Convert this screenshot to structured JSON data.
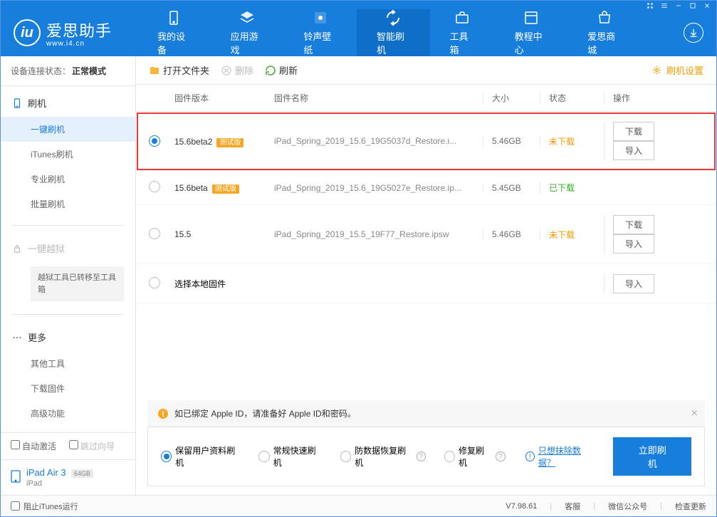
{
  "app": {
    "name": "爱思助手",
    "subtitle": "www.i4.cn"
  },
  "nav_tabs": [
    "我的设备",
    "应用游戏",
    "铃声壁纸",
    "智能刷机",
    "工具箱",
    "教程中心",
    "爱思商城"
  ],
  "conn_status": {
    "label": "设备连接状态：",
    "value": "正常模式"
  },
  "sidebar": {
    "flash": {
      "title": "刷机",
      "items": [
        "一键刷机",
        "iTunes刷机",
        "专业刷机",
        "批量刷机"
      ]
    },
    "jailbreak": {
      "title": "一键越狱",
      "notice": "越狱工具已转移至工具箱"
    },
    "more": {
      "title": "更多",
      "items": [
        "其他工具",
        "下载固件",
        "高级功能"
      ]
    }
  },
  "sidebar_footer": {
    "auto_activate": "自动激活",
    "skip_wizard": "跳过向导",
    "device_name": "iPad Air 3",
    "storage": "64GB",
    "device_type": "iPad"
  },
  "toolbar": {
    "open_folder": "打开文件夹",
    "delete": "删除",
    "refresh": "刷新",
    "settings": "刷机设置"
  },
  "table_headers": {
    "version": "固件版本",
    "name": "固件名称",
    "size": "大小",
    "status": "状态",
    "action": "操作"
  },
  "firmware": [
    {
      "version": "15.6beta2",
      "beta": true,
      "name": "iPad_Spring_2019_15.6_19G5037d_Restore.i...",
      "size": "5.46GB",
      "status": "未下载",
      "selected": true,
      "highlighted": true,
      "download": true,
      "import": true
    },
    {
      "version": "15.6beta",
      "beta": true,
      "name": "iPad_Spring_2019_15.6_19G5027e_Restore.ip...",
      "size": "5.45GB",
      "status": "已下载",
      "selected": false,
      "highlighted": false
    },
    {
      "version": "15.5",
      "beta": false,
      "name": "iPad_Spring_2019_15.5_19F77_Restore.ipsw",
      "size": "5.46GB",
      "status": "未下载",
      "selected": false,
      "highlighted": false,
      "download": true,
      "import": true
    }
  ],
  "local_firmware": "选择本地固件",
  "actions": {
    "download": "下载",
    "import": "导入"
  },
  "notice": "如已绑定 Apple ID，请准备好 Apple ID和密码。",
  "flash_options": [
    "保留用户资料刷机",
    "常规快速刷机",
    "防数据恢复刷机",
    "修复刷机"
  ],
  "erase_link": "只想抹除数据？",
  "flash_now": "立即刷机",
  "footer": {
    "prevent_itunes": "阻止iTunes运行",
    "version": "V7.98.61",
    "support": "客服",
    "wechat": "微信公众号",
    "check_update": "检查更新"
  }
}
